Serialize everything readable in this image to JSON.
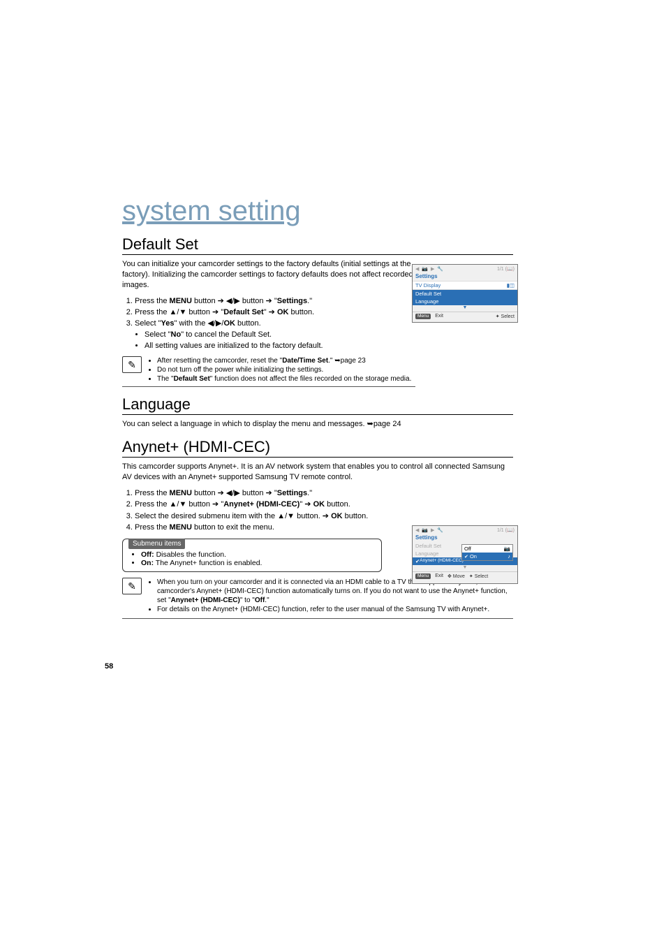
{
  "page_number": "58",
  "title": "system setting",
  "d": {
    "heading": "Default Set",
    "intro": "You can initialize your camcorder settings to the factory defaults (initial settings at the factory). Initializing the camcorder settings to factory defaults does not affect recorded images.",
    "s1_a": "Press the ",
    "s1_menu": "MENU",
    "s1_b": " button ➔ ◀/▶ button ➔ \"",
    "s1_set": "Settings",
    "s1_c": ".\"",
    "s2_a": "Press the ▲/▼ button ➔ \"",
    "s2_ds": "Default Set",
    "s2_b": "\" ➔ ",
    "s2_ok": "OK",
    "s2_c": " button.",
    "s3_a": "Select \"",
    "s3_yes": "Yes",
    "s3_b": "\" with the ◀/▶/",
    "s3_ok": "OK",
    "s3_c": " button.",
    "b1_a": "Select \"",
    "b1_no": "No",
    "b1_b": "\" to cancel the Default Set.",
    "b2": "All setting values are initialized to the factory default.",
    "n1_a": "After resetting the camcorder, reset the \"",
    "n1_dt": "Date/Time Set",
    "n1_b": ".\" ➥page 23",
    "n2": "Do not turn off the power while initializing the settings.",
    "n3_a": "The \"",
    "n3_ds": "Default Set",
    "n3_b": "\" function does not affect the files recorded on the storage media."
  },
  "l": {
    "heading": "Language",
    "text": "You can select a language in which to display the menu and messages. ➥page 24"
  },
  "a": {
    "heading": "Anynet+ (HDMI-CEC)",
    "intro": "This camcorder supports Anynet+. It is an AV network system that enables you to control all connected Samsung AV devices with an Anynet+ supported Samsung TV remote control.",
    "s1_a": "Press the ",
    "s1_menu": "MENU",
    "s1_b": " button ➔ ◀/▶ button ➔ \"",
    "s1_set": "Settings",
    "s1_c": ".\"",
    "s2_a": "Press the ▲/▼ button ➔ \"",
    "s2_any": "Anynet+ (HDMI-CEC)",
    "s2_b": "\" ➔ ",
    "s2_ok": "OK",
    "s2_c": " button.",
    "s3_a": "Select the desired submenu item with the ▲/▼ button. ➔ ",
    "s3_ok": "OK",
    "s3_b": " button.",
    "s4_a": "Press the ",
    "s4_menu": "MENU",
    "s4_b": " button to exit the menu.",
    "sub_title": "Submenu items",
    "sub_off_l": "Off:",
    "sub_off_t": " Disables the function.",
    "sub_on_l": "On:",
    "sub_on_t": " The Anynet+ function is enabled.",
    "n1_a": "When you turn on your camcorder and it is connected via an HDMI cable to a TV that supports Anynet+, the camcorder's Anynet+ (HDMI-CEC) function automatically turns on. If you do not want to use the Anynet+ function, set \"",
    "n1_any": "Anynet+ (HDMI-CEC)",
    "n1_b": "\" to \"",
    "n1_off": "Off",
    "n1_c": ".\"",
    "n2": "For details on the Anynet+ (HDMI-CEC) function, refer to the user manual of the Samsung TV with Anynet+."
  },
  "osd1": {
    "top_icons": "◀ 📷 ▶ 🔧",
    "top_right": "1/1     (📖)",
    "settings": "Settings",
    "r1": "TV Display",
    "r1v": "▮◫",
    "r2": "Default Set",
    "r3": "Language",
    "menu": "Menu",
    "exit": "Exit",
    "select": "Select"
  },
  "osd2": {
    "top_icons": "◀ 📷 ▶ 🔧",
    "top_right": "1/1     (📖)",
    "settings": "Settings",
    "r1": "Default Set",
    "r2": "Language",
    "r3": "Anynet+ (HDMI-CEC)",
    "p_off": "Off",
    "p_on": "On",
    "menu": "Menu",
    "exit": "Exit",
    "move": "Move",
    "select": "Select"
  }
}
